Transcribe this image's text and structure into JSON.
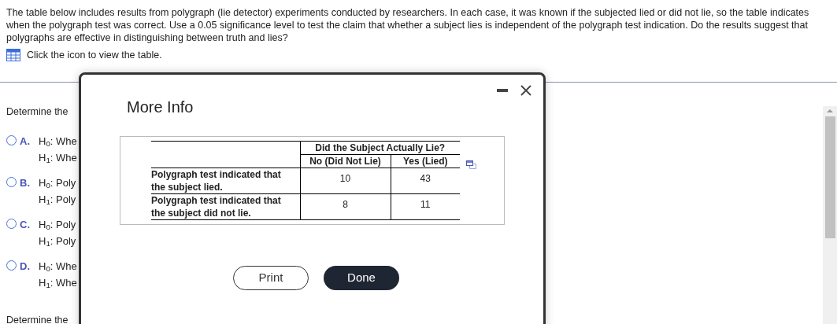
{
  "question": {
    "text": "The table below includes results from polygraph (lie detector) experiments conducted by researchers. In each case, it was known if the subjected lied or did not lie, so the table indicates when the polygraph test was correct. Use a 0.05 significance level to test the claim that whether a subject lies is independent of the polygraph test indication. Do the results suggest that polygraphs are effective in distinguishing between truth and lies?",
    "table_link": "Click the icon to view the table."
  },
  "prompt_1": "Determine the",
  "options": [
    {
      "letter": "A.",
      "lines": [
        "H$_{0}$: Whe",
        "H$_{1}$: Whe"
      ],
      "selected": false
    },
    {
      "letter": "B.",
      "lines": [
        "H$_{0}$: Poly",
        "H$_{1}$: Poly"
      ],
      "selected": false
    },
    {
      "letter": "C.",
      "lines": [
        "H$_{0}$: Poly",
        "H$_{1}$: Poly"
      ],
      "selected": false
    },
    {
      "letter": "D.",
      "lines": [
        "H$_{0}$: Whe",
        "H$_{1}$: Whe"
      ],
      "selected": false
    }
  ],
  "prompt_2": "Determine the",
  "dialog": {
    "title": "More Info",
    "table": {
      "group_header": "Did the Subject Actually Lie?",
      "columns": [
        "No (Did Not Lie)",
        "Yes (Lied)"
      ],
      "rows": [
        {
          "label": "Polygraph test indicated that the subject lied.",
          "values": [
            "10",
            "43"
          ]
        },
        {
          "label": "Polygraph test indicated that the subject did not lie.",
          "values": [
            "8",
            "11"
          ]
        }
      ]
    },
    "buttons": [
      {
        "label": "Print",
        "kind": "outline"
      },
      {
        "label": "Done",
        "kind": "primary"
      }
    ]
  }
}
